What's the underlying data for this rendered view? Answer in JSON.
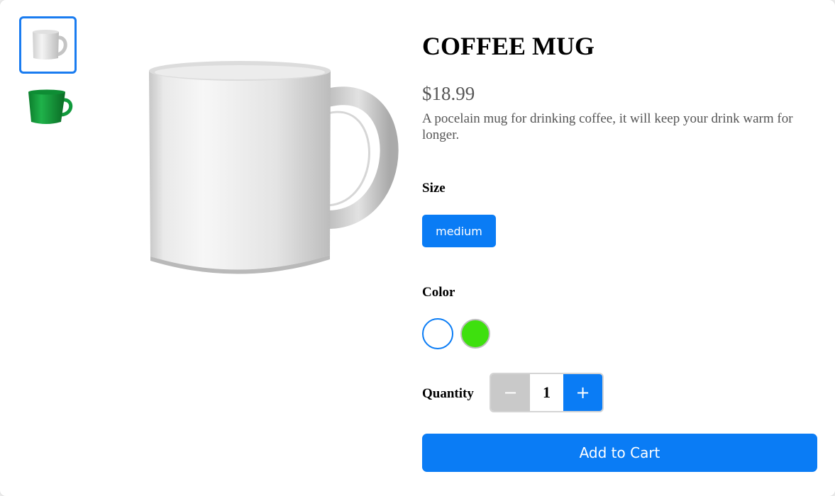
{
  "product": {
    "title": "COFFEE MUG",
    "price": "$18.99",
    "description": "A pocelain mug for drinking coffee, it will keep your drink warm for longer."
  },
  "thumbnails": [
    {
      "icon": "white-mug-image",
      "selected": true
    },
    {
      "icon": "green-mug-image",
      "selected": false
    }
  ],
  "main_image": {
    "icon": "white-mug-image"
  },
  "size": {
    "label": "Size",
    "options": [
      "medium"
    ],
    "selected": "medium"
  },
  "color": {
    "label": "Color",
    "swatches": [
      {
        "name": "white",
        "hex": "#ffffff",
        "selected": true
      },
      {
        "name": "green",
        "hex": "#3ee00e",
        "selected": false
      }
    ]
  },
  "quantity": {
    "label": "Quantity",
    "value": "1",
    "decrement_label": "−",
    "increment_label": "+"
  },
  "cart": {
    "button_label": "Add to Cart"
  },
  "colors": {
    "accent": "#0a7cf5",
    "disabled": "#c9c9c9",
    "text_muted": "#555555"
  }
}
